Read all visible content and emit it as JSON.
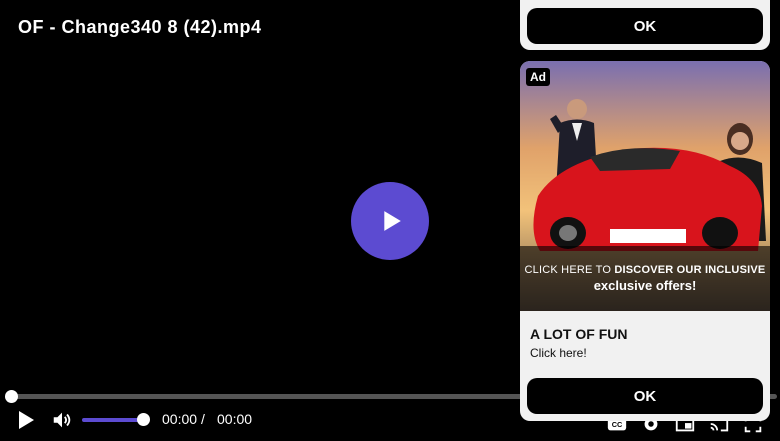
{
  "video": {
    "title": "OF - Change340 8 (42).mp4",
    "current_time": "00:00",
    "separator": "/",
    "duration": "00:00",
    "progress": 0,
    "volume": 1.0,
    "accent_color": "#5c4bd1"
  },
  "icons": {
    "big_play": "play-icon",
    "play": "play-icon",
    "volume": "volume-icon",
    "captions": "captions-icon",
    "settings": "gear-icon",
    "pip": "picture-in-picture-icon",
    "cast": "cast-icon",
    "fullscreen": "fullscreen-icon"
  },
  "ad_top": {
    "ok_label": "OK"
  },
  "ad_card": {
    "badge": "Ad",
    "banner_prefix": "CLICK HERE TO",
    "banner_bold": "DISCOVER OUR INCLUSIVE",
    "banner_line2": "exclusive offers!",
    "headline": "A LOT OF FUN",
    "subtext": "Click here!",
    "ok_label": "OK"
  }
}
